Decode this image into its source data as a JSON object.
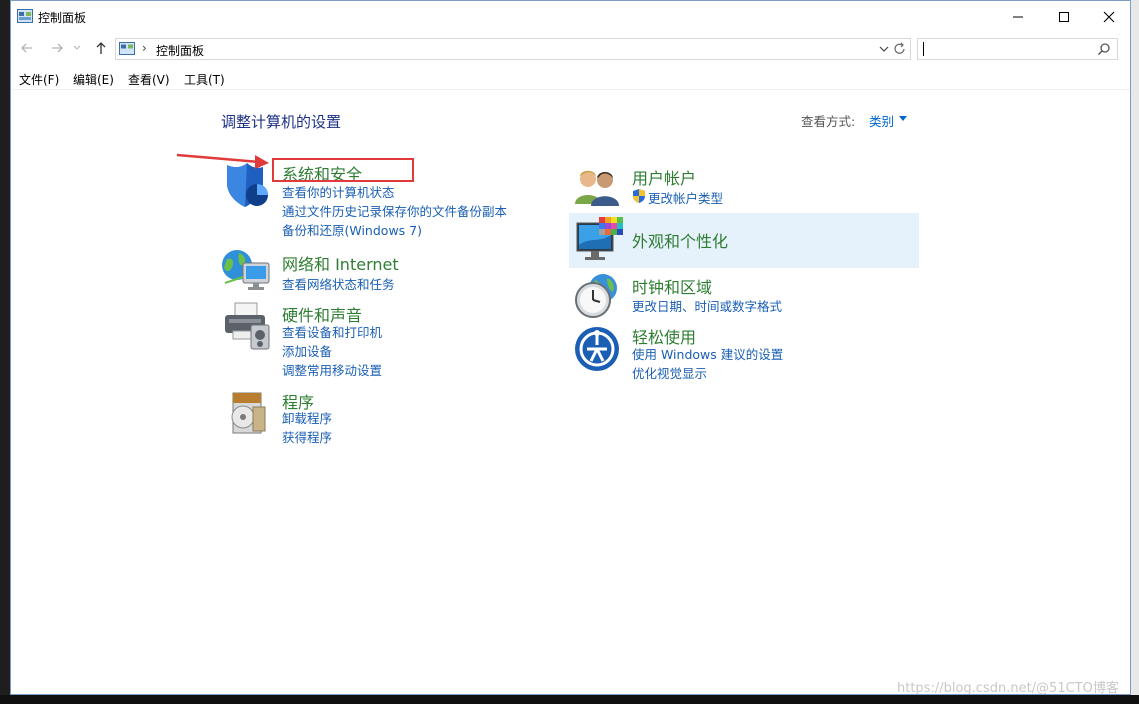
{
  "window": {
    "title": "控制面板",
    "controls": {
      "minimize": "—",
      "maximize": "☐",
      "close": "✕"
    }
  },
  "navbar": {
    "address_path": "控制面板",
    "address_separator": "›",
    "search_placeholder": ""
  },
  "menubar": {
    "items": [
      "文件(F)",
      "编辑(E)",
      "查看(V)",
      "工具(T)"
    ]
  },
  "main": {
    "heading": "调整计算机的设置",
    "view_by_label": "查看方式:",
    "view_by_value": "类别",
    "categories_left": [
      {
        "title": "系统和安全",
        "icon": "shield-icon",
        "links": [
          "查看你的计算机状态",
          "通过文件历史记录保存你的文件备份副本",
          "备份和还原(Windows 7)"
        ]
      },
      {
        "title": "网络和 Internet",
        "icon": "globe-network-icon",
        "links": [
          "查看网络状态和任务"
        ]
      },
      {
        "title": "硬件和声音",
        "icon": "printer-icon",
        "links": [
          "查看设备和打印机",
          "添加设备",
          "调整常用移动设置"
        ]
      },
      {
        "title": "程序",
        "icon": "program-disk-icon",
        "links": [
          "卸载程序",
          "获得程序"
        ]
      }
    ],
    "categories_right": [
      {
        "title": "用户帐户",
        "icon": "users-icon",
        "links": [
          "更改帐户类型"
        ]
      },
      {
        "title": "外观和个性化",
        "icon": "monitor-palette-icon",
        "links": []
      },
      {
        "title": "时钟和区域",
        "icon": "clock-globe-icon",
        "links": [
          "更改日期、时间或数字格式"
        ]
      },
      {
        "title": "轻松使用",
        "icon": "ease-of-access-icon",
        "links": [
          "使用 Windows 建议的设置",
          "优化视觉显示"
        ]
      }
    ]
  },
  "colors": {
    "category_title": "#2e7d32",
    "link": "#1a5fb4",
    "heading": "#1e3287",
    "highlight": "#e5f1fb",
    "annotation": "#e03a3a"
  },
  "watermark": "https://blog.csdn.net/@51CTO博客"
}
